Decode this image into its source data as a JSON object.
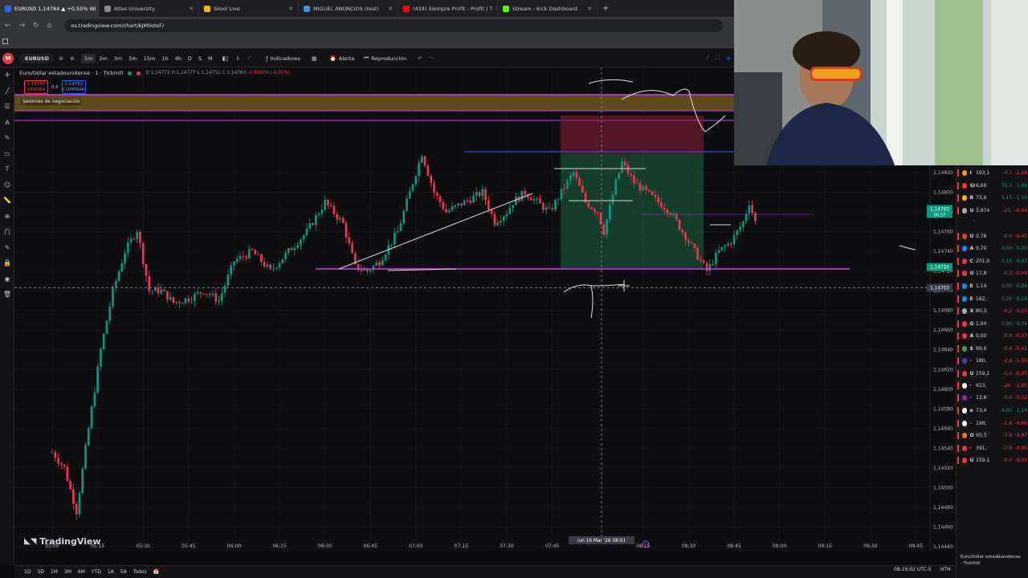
{
  "browser": {
    "tabs": [
      {
        "label": "EURUSD 1,14784 ▲ +0,55% Wi",
        "active": true,
        "color": "#2962ff"
      },
      {
        "label": "Atlas University",
        "active": false,
        "color": "#8a8a8a"
      },
      {
        "label": "Skool Live",
        "active": false,
        "color": "#f0b90b"
      },
      {
        "label": "MIGUEL ANUNCIOS (real)",
        "active": false,
        "color": "#4a90e2"
      },
      {
        "label": "(434) Siempre Profit - Profit | T",
        "active": false,
        "color": "#ff0000"
      },
      {
        "label": "Stream - Kick Dashboard",
        "active": false,
        "color": "#53fc18"
      }
    ],
    "url": "es.tradingview.com/chart/kJMSotsF/"
  },
  "toolbar": {
    "symbol": "EURUSD",
    "timeframes": [
      "1m",
      "2m",
      "3m",
      "5m",
      "15m",
      "1h",
      "4h",
      "D",
      "S",
      "M"
    ],
    "active_timeframe": "1m",
    "indicators_label": "Indicadores",
    "alert_label": "Alerta",
    "replay_label": "Reproducción"
  },
  "legend": {
    "title": "Euro/Dólar estadounidense · 1 · Tickmill",
    "o": "O 1,14772",
    "h": "H 1,14777",
    "l": "L 1,14751",
    "c": "C 1,14763",
    "chg": "-0,00009 (-0,01%)",
    "sell_price": "1,14787",
    "sell_label": "VENDER",
    "spread": "0,6",
    "buy_price": "1,14783",
    "buy_label": "COMPRAR",
    "sessions": "Sesiones de negociación"
  },
  "chart_data": {
    "type": "line",
    "title": "Euro/Dólar estadounidense · 1 · Tickmill",
    "y_ticks": [
      "1,14820",
      "1,14800",
      "1,14780",
      "1,14760",
      "1,14740",
      "1,14720",
      "1,14700",
      "1,14680",
      "1,14660",
      "1,14640",
      "1,14620",
      "1,14600",
      "1,14580",
      "1,14560",
      "1,14540",
      "1,14520",
      "1,14500",
      "1,14480",
      "1,14460",
      "1,14440"
    ],
    "x_ticks": [
      "05:00",
      "05:15",
      "05:30",
      "05:45",
      "06:00",
      "06:15",
      "06:30",
      "06:45",
      "07:00",
      "07:15",
      "07:30",
      "07:45",
      "08:15",
      "08:30",
      "08:45",
      "09:00",
      "09:15",
      "09:30",
      "09:45"
    ],
    "ylim": [
      1.1444,
      1.1483
    ],
    "price_label": "1,14783",
    "price_sub": "00:57",
    "level_label": "1,14724",
    "crosshair_price": "1,14703",
    "crosshair_time": "lun 16 Mar '26   08:01",
    "colors": {
      "up": "#089981",
      "down": "#f23645",
      "level": "#c940f0"
    }
  },
  "bottom": {
    "ranges": [
      "1D",
      "5D",
      "1M",
      "3M",
      "6M",
      "YTD",
      "1A",
      "5A",
      "Todos"
    ],
    "clock": "08:16:02 UTC-5",
    "hth": "HTH",
    "logo": "TradingView"
  },
  "watchlist": {
    "rows": [
      {
        "s": "I",
        "p": "193,1",
        "c": "-4,3",
        "pc": "-2,18",
        "col": "#f7931a",
        "dir": "neg"
      },
      {
        "s": "SI",
        "p": "6,69",
        "c": "71,3",
        "pc": "1,08",
        "col": "#f23645",
        "dir": "pos"
      },
      {
        "s": "B",
        "p": "73,9",
        "c": "1,15",
        "pc": "1,59",
        "col": "#f0b90b",
        "dir": "pos"
      },
      {
        "s": "U",
        "p": "3.674",
        "c": "-23,",
        "pc": "-0,64",
        "col": "#aaa",
        "dir": "neg"
      },
      {
        "s": "U",
        "p": "0,78",
        "c": "-0,0",
        "pc": "-0,45",
        "col": "#e53935",
        "dir": "neg"
      },
      {
        "s": "A",
        "p": "0,70",
        "c": "0,00",
        "pc": "0,00",
        "col": "#1e88e5",
        "dir": "pos"
      },
      {
        "s": "C",
        "p": "201,0",
        "c": "0,15",
        "pc": "0,07",
        "col": "#e53935",
        "dir": "pos"
      },
      {
        "s": "U",
        "p": "17,8",
        "c": "-0,0",
        "pc": "-0,44",
        "col": "#e53935",
        "dir": "neg"
      },
      {
        "s": "E",
        "p": "1,14",
        "c": "0,00",
        "pc": "0,54",
        "col": "#1e88e5",
        "dir": "pos"
      },
      {
        "s": "E",
        "p": "182,",
        "c": "0,26",
        "pc": "0,14",
        "col": "#1e88e5",
        "dir": "pos"
      },
      {
        "s": "X",
        "p": "80,3",
        "c": "-0,2",
        "pc": "-0,25",
        "col": "#aaa",
        "dir": "neg"
      },
      {
        "s": "G",
        "p": "1,04",
        "c": "0,00",
        "pc": "0,04",
        "col": "#e53935",
        "dir": "pos"
      },
      {
        "s": "A",
        "p": "0,00",
        "c": "-0,0",
        "pc": "-0,07",
        "col": "#e53935",
        "dir": "neg"
      },
      {
        "s": "$",
        "p": "99,9",
        "c": "-0,4",
        "pc": "-0,41",
        "col": "#43a047",
        "dir": "neg"
      },
      {
        "s": "·",
        "p": "180,",
        "c": "-2,8",
        "pc": "-1,56",
        "col": "#3949ab",
        "dir": "neg"
      },
      {
        "s": "U",
        "p": "159,1",
        "c": "-0,0",
        "pc": "-0,05",
        "col": "#e53935",
        "dir": "neg"
      },
      {
        "s": "·",
        "p": "613,",
        "c": "-24,",
        "pc": "-3,85",
        "col": "#eee",
        "dir": "neg"
      },
      {
        "s": "·",
        "p": "13,8",
        "c": "-0,0",
        "pc": "-0,52",
        "col": "#8e24aa",
        "dir": "neg"
      },
      {
        "s": "e",
        "p": "73,4",
        "c": "0,83",
        "pc": "1,14",
        "col": "#fff",
        "dir": "pos"
      },
      {
        "s": "·",
        "p": "196,",
        "c": "-1,6",
        "pc": "-0,86",
        "col": "#eee",
        "dir": "neg"
      },
      {
        "s": "O",
        "p": "95,3",
        "c": "-3,8",
        "pc": "-3,97",
        "col": "#f57c00",
        "dir": "neg"
      },
      {
        "s": "·",
        "p": "391,",
        "c": "-3,8",
        "pc": "-0,98",
        "col": "#e53935",
        "dir": "neg"
      },
      {
        "s": "U",
        "p": "159,1",
        "c": "-0,0",
        "pc": "-0,05",
        "col": "#e53935",
        "dir": "neg"
      }
    ],
    "footer_title": "Euro/Dólar estadounidense",
    "footer_broker": "· Tickmill"
  }
}
